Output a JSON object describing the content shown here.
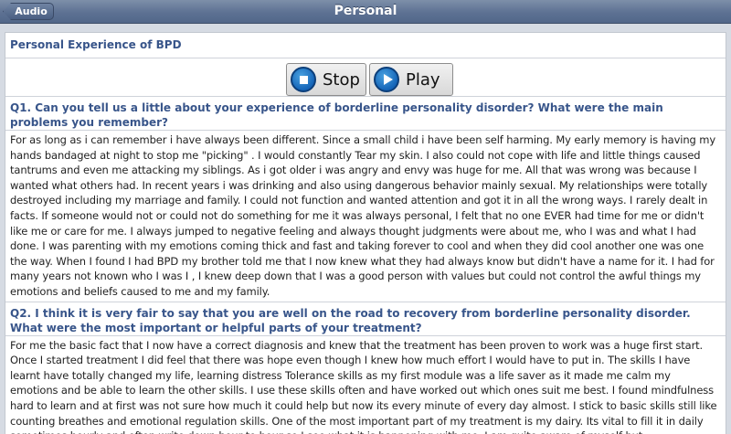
{
  "navbar": {
    "back_label": "Audio",
    "title": "Personal"
  },
  "section": {
    "title": "Personal Experience of BPD"
  },
  "controls": {
    "stop_label": "Stop",
    "play_label": "Play"
  },
  "qa": [
    {
      "question": "Q1. Can you tell us a little about your experience of borderline personality disorder?  What were the main problems you remember?",
      "answer": "For as long as i can remember i have always been different. Since a small child i have been self harming. My early memory is having my hands bandaged at night to stop me \"picking\" . I would constantly Tear my skin. I also could not cope with life and little things caused tantrums and even me attacking my siblings. As i got older i was angry and envy was huge for me.   All that was wrong was because I wanted what others had.  In recent  years i was drinking and also using dangerous behavior mainly sexual. My relationships were totally destroyed including my marriage and family. I could not function and wanted attention and got it in all the wrong ways.  I rarely dealt in facts.  If someone would not or could not do something for me it was always personal, I felt that no one EVER had time for me or didn't like me or care for me.  I always jumped to negative feeling and always thought judgments were about me, who I was and what I had done.  I was parenting with my emotions coming thick and fast and taking forever to cool and when they did cool another one was one the way.  When I found I had BPD my brother told me that I now knew what they had always know but didn't have a name for it.  I had for many years not known who I was I , I knew deep down that I was a good person with values but could not control the awful things my emotions and beliefs caused to me and my family."
    },
    {
      "question": "Q2. I think it is very fair to say that you are well on the road to recovery from borderline personality disorder.  What were the most important or helpful parts of your treatment?",
      "answer": "For me the basic fact that I now have a correct diagnosis and knew that the treatment has been proven to work was a huge first start.  Once I started treatment I did feel that there was hope even though I knew how much effort I would have to put in.  The skills I have learnt have totally changed my life, learning distress Tolerance skills as my first module was a life saver as it made me calm my emotions and be able to learn the other skills. I use these skills often and have worked out which ones suit me best.  I found mindfulness hard to learn and at first was not sure how much it could help but now its every minute of every day almost.  I stick to basic skills still like counting breathes and emotional regulation skills.  One of the most important part of my treatment is my dairy. Its vital to fill it in daily sometimes hourly and often write down hour to hour so I see what it is happening with me. I am quite aware of myself but"
    }
  ]
}
